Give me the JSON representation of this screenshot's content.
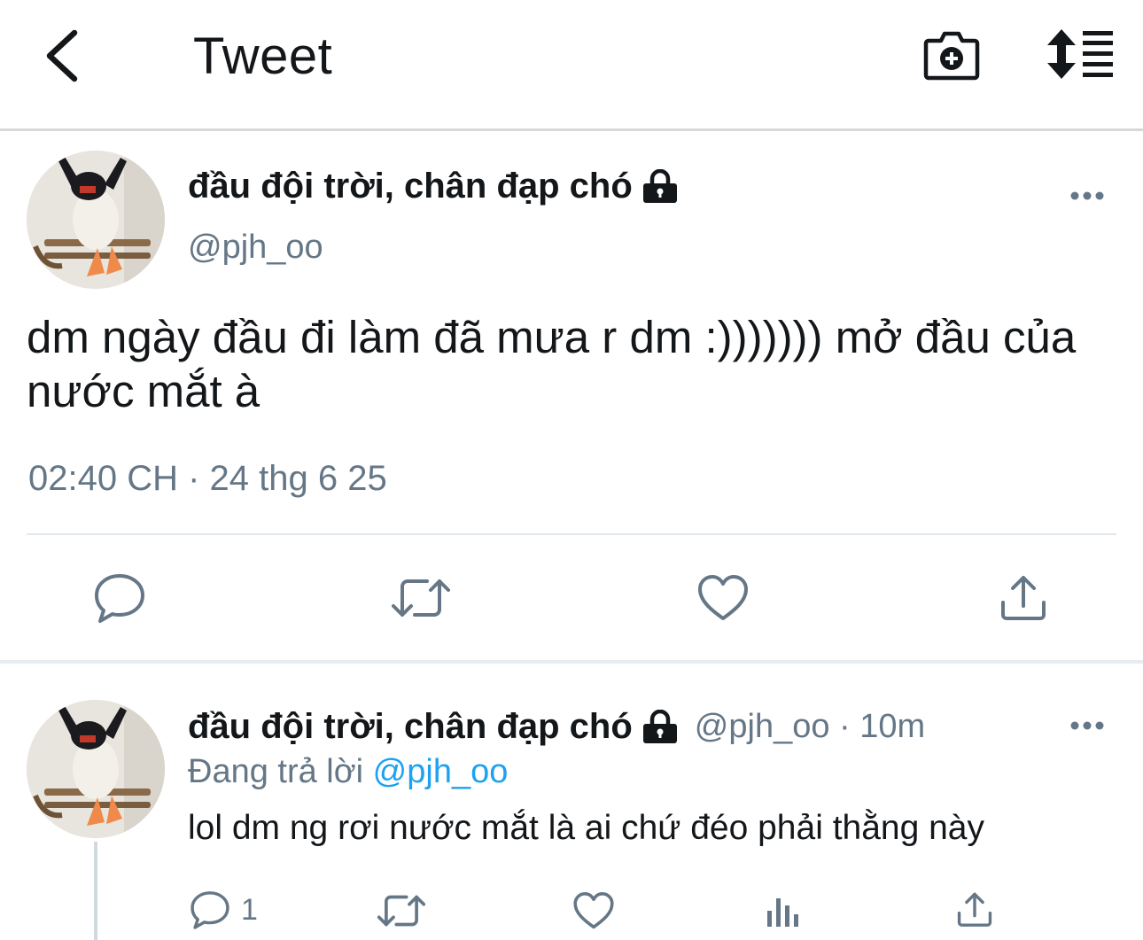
{
  "header": {
    "title": "Tweet",
    "back_icon": "chevron-left-icon",
    "camera_icon": "camera-add-icon",
    "sort_icon": "sort-icon"
  },
  "main_tweet": {
    "display_name": "đầu đội trời, chân đạp chó",
    "handle": "@pjh_oo",
    "text": "dm ngày đầu đi làm đã mưa r dm :))))))) mở đầu của nước mắt à",
    "timestamp": "02:40 CH · 24 thg 6 25",
    "actions": [
      "reply-icon",
      "retweet-icon",
      "like-icon",
      "share-icon"
    ]
  },
  "reply": {
    "display_name": "đầu đội trời, chân đạp chó",
    "handle_time": "@pjh_oo · 10m",
    "replying_prefix": "Đang trả lời",
    "replying_to": "@pjh_oo",
    "text": "lol dm ng rơi nước mắt là ai chứ đéo phải thằng này",
    "reply_count": "1"
  },
  "colors": {
    "text": "#14171a",
    "secondary": "#657786",
    "accent": "#1da1f2",
    "icon": "#657786"
  }
}
